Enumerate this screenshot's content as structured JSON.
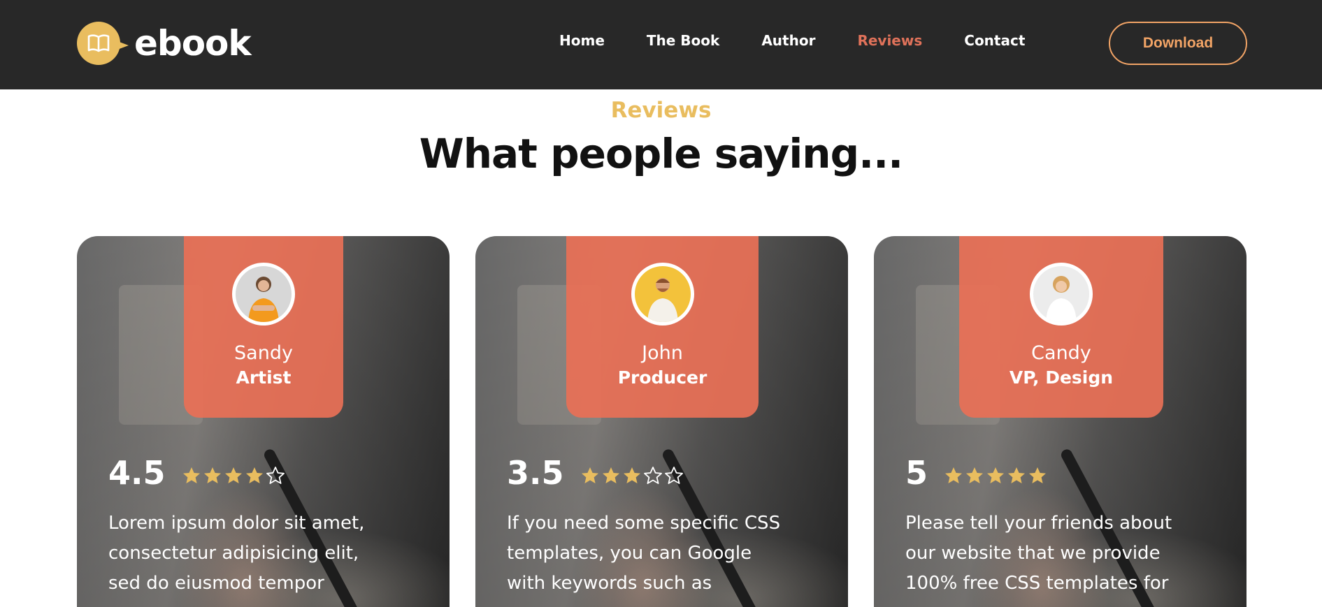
{
  "brand": {
    "name": "ebook"
  },
  "nav": {
    "links": [
      "Home",
      "The Book",
      "Author",
      "Reviews",
      "Contact"
    ],
    "active": "Reviews",
    "download_label": "Download"
  },
  "section": {
    "eyebrow": "Reviews",
    "title": "What people saying..."
  },
  "colors": {
    "nav_bg": "#282828",
    "accent_gold": "#e9bd5f",
    "accent_orange": "#f2a466",
    "card_panel": "#e87056",
    "star": "#e9bd5f"
  },
  "reviews": [
    {
      "name": "Sandy",
      "role": "Artist",
      "rating": "4.5",
      "stars": [
        "full",
        "full",
        "full",
        "full",
        "empty"
      ],
      "lines": [
        "Lorem ipsum dolor sit amet,",
        "consectetur adipisicing elit,",
        "sed do eiusmod tempor"
      ]
    },
    {
      "name": "John",
      "role": "Producer",
      "rating": "3.5",
      "stars": [
        "full",
        "full",
        "full",
        "empty",
        "empty"
      ],
      "lines": [
        "If you need some specific CSS",
        "templates, you can Google",
        "with keywords such as"
      ]
    },
    {
      "name": "Candy",
      "role": "VP, Design",
      "rating": "5",
      "stars": [
        "full",
        "full",
        "full",
        "full",
        "full"
      ],
      "lines": [
        "Please tell your friends about",
        "our website that we provide",
        "100% free CSS templates for"
      ]
    }
  ]
}
